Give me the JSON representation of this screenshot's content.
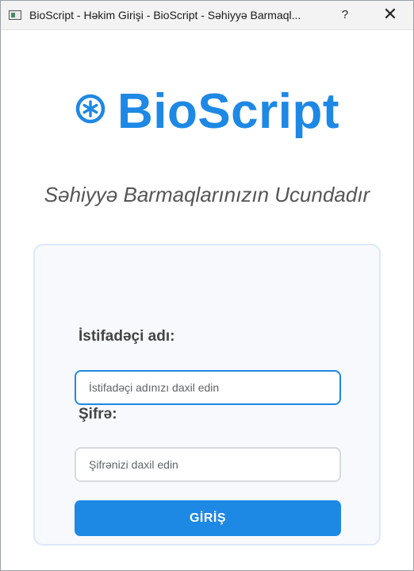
{
  "window": {
    "title": "BioScript - Həkim Girişi - BioScript - Səhiyyə Barmaql...",
    "help_label": "?",
    "close_label": "✕",
    "app_icon": "window-app-icon"
  },
  "brand": {
    "logo_icon": "asterisk-circle-icon",
    "name": "BioScript",
    "slogan": "Səhiyyə Barmaqlarınızın Ucundadır",
    "accent_color": "#1e88e5"
  },
  "login_form": {
    "username_label": "İstifadəçi adı:",
    "username_placeholder": "İstifadəçi adınızı daxil edin",
    "username_value": "",
    "password_label": "Şifrə:",
    "password_placeholder": "Şifrənizi daxil edin",
    "password_value": "",
    "submit_label": "GİRİŞ"
  }
}
